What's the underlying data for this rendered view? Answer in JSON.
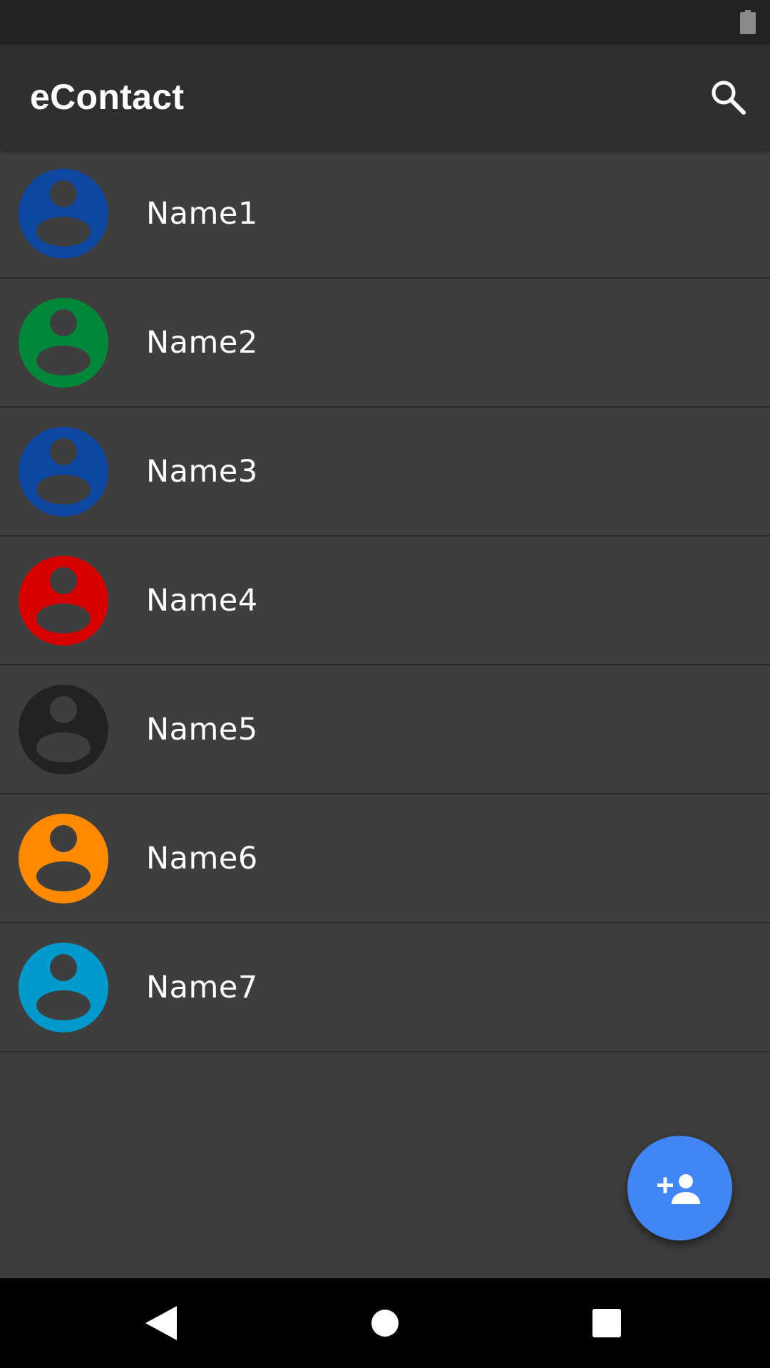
{
  "app": {
    "title": "eContact"
  },
  "icons": {
    "search": "search-icon",
    "battery": "battery-icon",
    "fab": "add-person-icon",
    "back": "back-triangle-icon",
    "home": "home-circle-icon",
    "recents": "recents-square-icon"
  },
  "colors": {
    "status_bar": "#222222",
    "app_bar": "#2f2f2f",
    "background": "#3e3e3e",
    "fab": "#4285f4",
    "nav_bar": "#000000"
  },
  "contacts": [
    {
      "name": "Name1",
      "avatar_color": "#0d47a1"
    },
    {
      "name": "Name2",
      "avatar_color": "#00873a"
    },
    {
      "name": "Name3",
      "avatar_color": "#0d47a1"
    },
    {
      "name": "Name4",
      "avatar_color": "#d50000"
    },
    {
      "name": "Name5",
      "avatar_color": "#222222"
    },
    {
      "name": "Name6",
      "avatar_color": "#ff8a00"
    },
    {
      "name": "Name7",
      "avatar_color": "#0099cc"
    }
  ]
}
